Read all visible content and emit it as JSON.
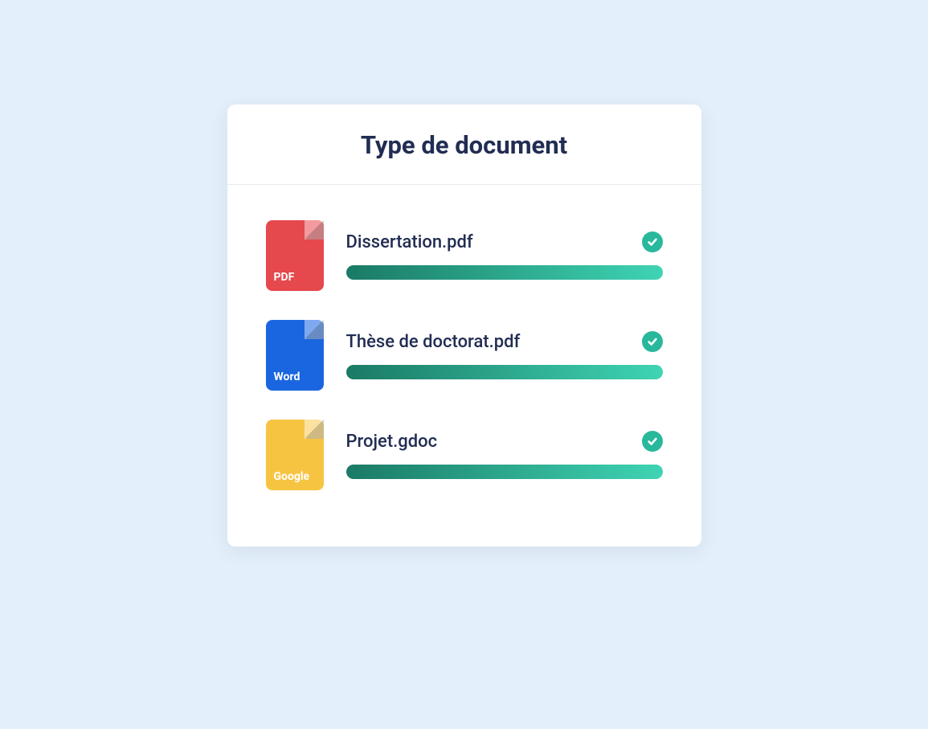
{
  "title": "Type de document",
  "files": [
    {
      "type_label": "PDF",
      "type_key": "pdf",
      "name": "Dissertation.pdf",
      "complete": true
    },
    {
      "type_label": "Word",
      "type_key": "word",
      "name": "Thèse de doctorat.pdf",
      "complete": true
    },
    {
      "type_label": "Google",
      "type_key": "google",
      "name": "Projet.gdoc",
      "complete": true
    }
  ],
  "colors": {
    "background": "#e3effa",
    "card": "#ffffff",
    "heading": "#212d53",
    "pdf": "#e5484d",
    "word": "#1a66e0",
    "google": "#f7c442",
    "progress_start": "#1a7a65",
    "progress_end": "#3fd4b4",
    "check": "#29b89b"
  }
}
